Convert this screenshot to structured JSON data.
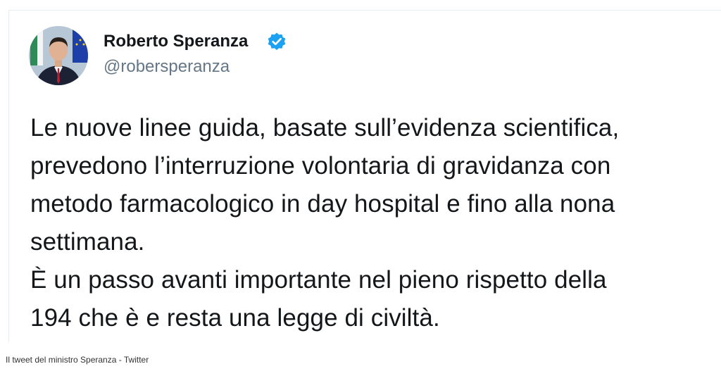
{
  "author": {
    "name": "Roberto Speranza",
    "handle": "@robersperanza",
    "verified": true,
    "verified_icon": "verified-badge-icon",
    "verified_color": "#1da1f2"
  },
  "tweet": {
    "lines": [
      "Le nuove linee guida, basate sull’evidenza scientifica,",
      "prevedono l’interruzione volontaria di gravidanza con",
      "metodo farmacologico in day hospital e fino alla nona",
      "settimana.",
      "È un passo avanti importante nel pieno rispetto della",
      "194 che è e resta una legge di civiltà."
    ]
  },
  "caption": "Il tweet del ministro Speranza - Twitter"
}
